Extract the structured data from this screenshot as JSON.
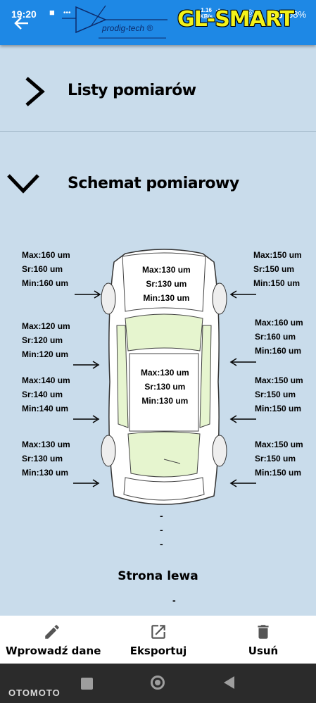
{
  "status_bar": {
    "time": "19:20",
    "speed": "1.16\nKB/s",
    "battery": "68%"
  },
  "header": {
    "logo_text": "prodig-tech ®",
    "brand": "GL-SMART"
  },
  "sections": [
    {
      "title": "Listy pomiarów",
      "expanded": false
    },
    {
      "title": "Schemat pomiarowy",
      "expanded": true
    }
  ],
  "measurements": {
    "left_front": {
      "max": "Max:160 um",
      "sr": "Sr:160 um",
      "min": "Min:160 um"
    },
    "left_door1": {
      "max": "Max:120 um",
      "sr": "Sr:120 um",
      "min": "Min:120 um"
    },
    "left_door2": {
      "max": "Max:140 um",
      "sr": "Sr:140 um",
      "min": "Min:140 um"
    },
    "left_rear": {
      "max": "Max:130 um",
      "sr": "Sr:130 um",
      "min": "Min:130 um"
    },
    "right_front": {
      "max": "Max:150 um",
      "sr": "Sr:150 um",
      "min": "Min:150 um"
    },
    "right_door1": {
      "max": "Max:160 um",
      "sr": "Sr:160 um",
      "min": "Min:160 um"
    },
    "right_door2": {
      "max": "Max:150 um",
      "sr": "Sr:150 um",
      "min": "Min:150 um"
    },
    "right_rear": {
      "max": "Max:150 um",
      "sr": "Sr:150 um",
      "min": "Min:150 um"
    },
    "hood": {
      "max": "Max:130 um",
      "sr": "Sr:130 um",
      "min": "Min:130 um"
    },
    "roof": {
      "max": "Max:130 um",
      "sr": "Sr:130 um",
      "min": "Min:130 um"
    }
  },
  "side_label": "Strona lewa",
  "actions": [
    {
      "label": "Wprowadź dane",
      "icon": "pencil-icon"
    },
    {
      "label": "Eksportuj",
      "icon": "export-icon"
    },
    {
      "label": "Usuń",
      "icon": "trash-icon"
    }
  ],
  "watermark": "OTOMOTO",
  "colors": {
    "app_bar": "#1e88e5",
    "background": "#c9dceb",
    "brand": "#f3f21a",
    "glass": "#e6f5cf"
  }
}
